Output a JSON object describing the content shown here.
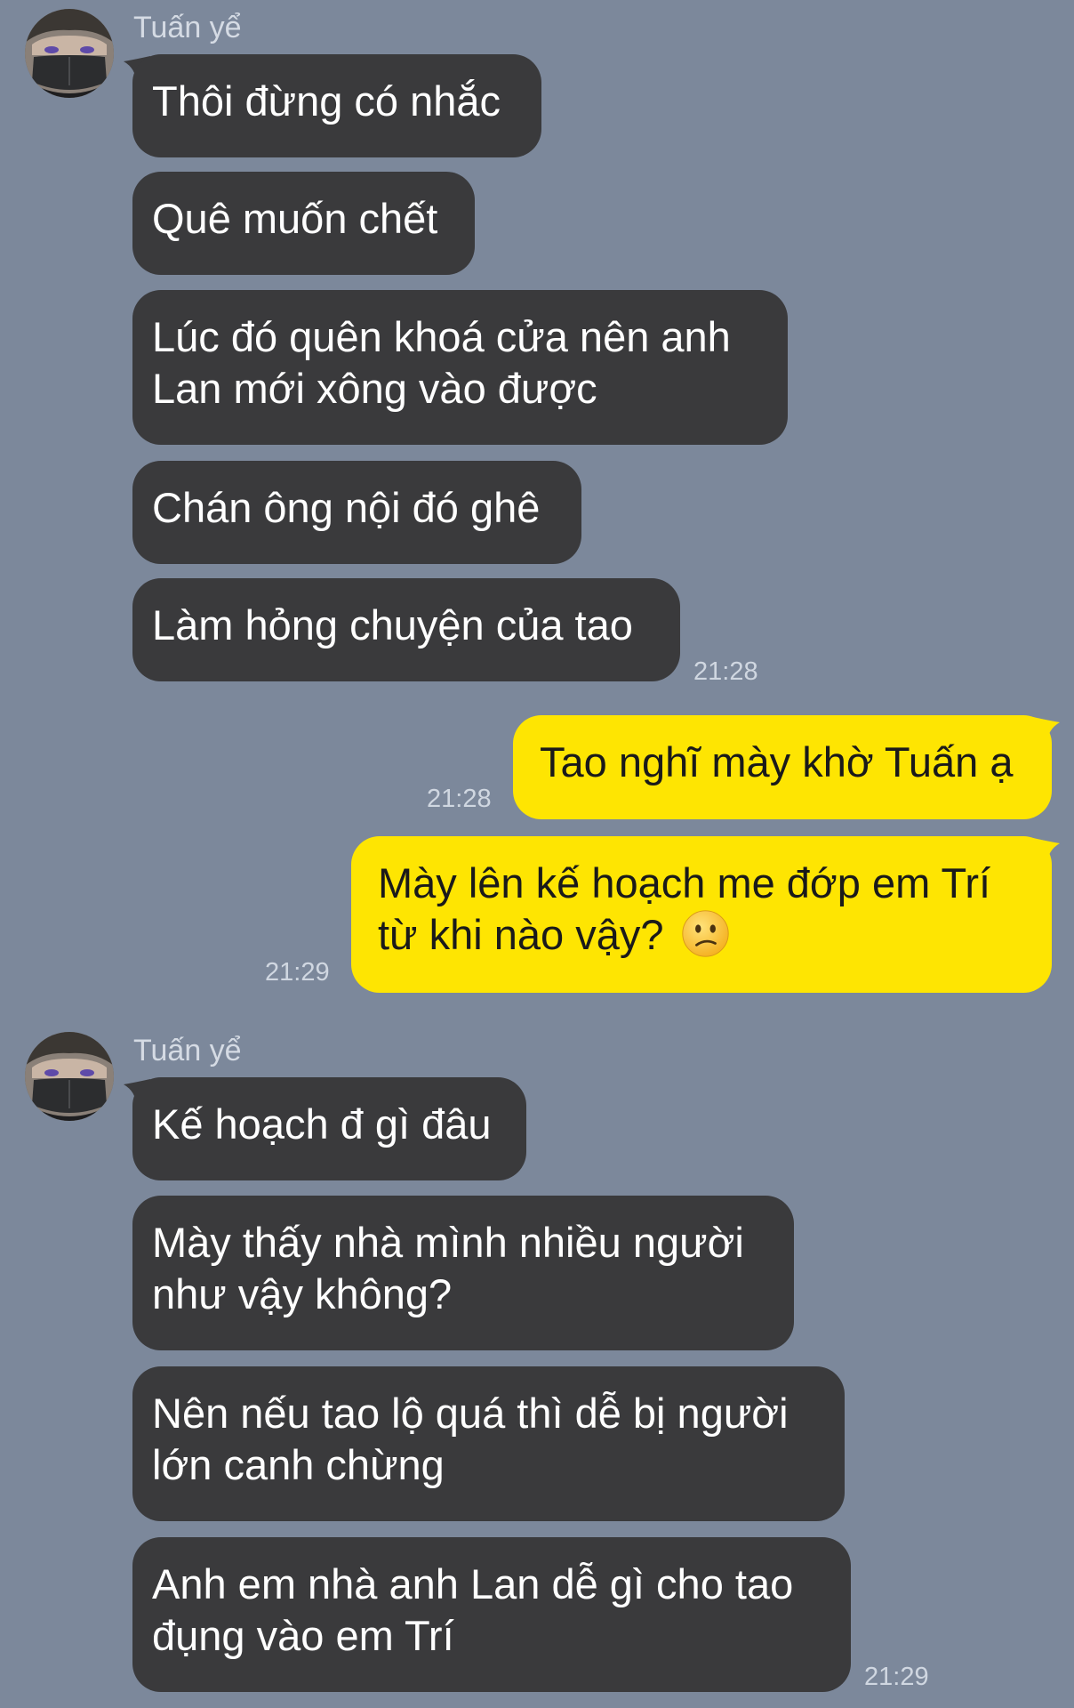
{
  "chat": {
    "contact_name": "Tuấn yể",
    "groups": [
      {
        "sender": "Tuấn yể",
        "messages": [
          {
            "lines": [
              "Thôi đừng có nhắc"
            ]
          },
          {
            "lines": [
              "Quê muốn chết"
            ]
          },
          {
            "lines": [
              "Lúc đó quên khoá cửa nên anh",
              "Lan mới xông vào được"
            ]
          },
          {
            "lines": [
              "Chán ông nội đó ghê"
            ]
          },
          {
            "lines": [
              "Làm hỏng chuyện của tao"
            ],
            "time": "21:28"
          }
        ]
      },
      {
        "sender": "me",
        "messages": [
          {
            "lines": [
              "Tao nghĩ mày khờ Tuấn ạ"
            ],
            "time": "21:28"
          },
          {
            "lines": [
              "Mày lên kế hoạch me đớp em Trí",
              "từ khi nào vậy?"
            ],
            "emoji": "confused-face-icon",
            "time": "21:29"
          }
        ]
      },
      {
        "sender": "Tuấn yể",
        "messages": [
          {
            "lines": [
              "Kế hoạch đ gì đâu"
            ]
          },
          {
            "lines": [
              "Mày thấy nhà mình nhiều người",
              "như vậy không?"
            ]
          },
          {
            "lines": [
              "Nên nếu tao lộ quá thì dễ bị người",
              "lớn canh chừng"
            ]
          },
          {
            "lines": [
              "Anh em nhà anh Lan dễ gì cho tao",
              "đụng vào em Trí"
            ],
            "time": "21:29"
          }
        ]
      }
    ]
  },
  "colors": {
    "background": "#7c889b",
    "incoming_bubble": "#3a3a3c",
    "outgoing_bubble": "#fee502",
    "incoming_text": "#ffffff",
    "outgoing_text": "#1a1a1a",
    "timestamp": "#d0d7e1"
  }
}
